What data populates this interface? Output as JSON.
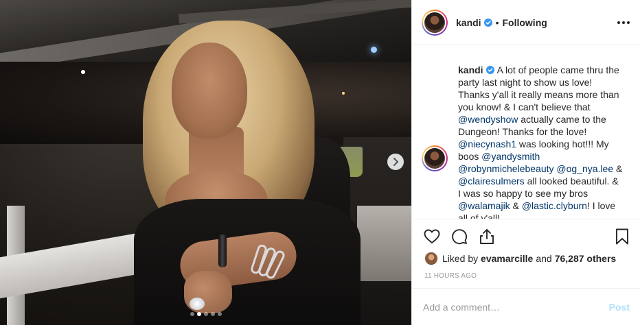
{
  "post": {
    "username": "kandi",
    "separator": "•",
    "follow_status": "Following",
    "verified_icon": "verified-badge-icon",
    "caption_segments": [
      {
        "type": "text",
        "value": "A lot of people came thru the party last night to show us love! Thanks y'all it really means more than you know! & I can't believe that "
      },
      {
        "type": "mention",
        "value": "@wendyshow"
      },
      {
        "type": "text",
        "value": " actually came to the Dungeon! Thanks for the love! "
      },
      {
        "type": "mention",
        "value": "@niecynash1"
      },
      {
        "type": "text",
        "value": " was looking hot!!! My boos "
      },
      {
        "type": "mention",
        "value": "@yandysmith"
      },
      {
        "type": "text",
        "value": " "
      },
      {
        "type": "mention",
        "value": "@robynmichelebeauty"
      },
      {
        "type": "text",
        "value": " "
      },
      {
        "type": "mention",
        "value": "@og_nya.lee"
      },
      {
        "type": "text",
        "value": " & "
      },
      {
        "type": "mention",
        "value": "@clairesulmers"
      },
      {
        "type": "text",
        "value": " all looked beautiful. & I was so happy to see my bros "
      },
      {
        "type": "mention",
        "value": "@walamajik"
      },
      {
        "type": "text",
        "value": " & "
      },
      {
        "type": "mention",
        "value": "@lastic.clyburn"
      },
      {
        "type": "text",
        "value": "! I love all of y'all!"
      }
    ],
    "likes": {
      "liked_by_prefix": "Liked by",
      "liked_by_user": "evamarcille",
      "and_text": "and",
      "others_count": "76,287 others"
    },
    "timestamp": "11 HOURS AGO",
    "carousel": {
      "total_slides": 5,
      "active_index": 1
    }
  },
  "comment_box": {
    "placeholder": "Add a comment…",
    "post_label": "Post"
  },
  "icons": {
    "more": "more-options-icon",
    "like": "heart-icon",
    "comment": "comment-icon",
    "share": "share-icon",
    "save": "bookmark-icon",
    "next": "chevron-right-icon"
  },
  "colors": {
    "mention": "#003569",
    "verified": "#3897f0",
    "post_disabled": "#b2dffc",
    "meta_gray": "#999999"
  }
}
